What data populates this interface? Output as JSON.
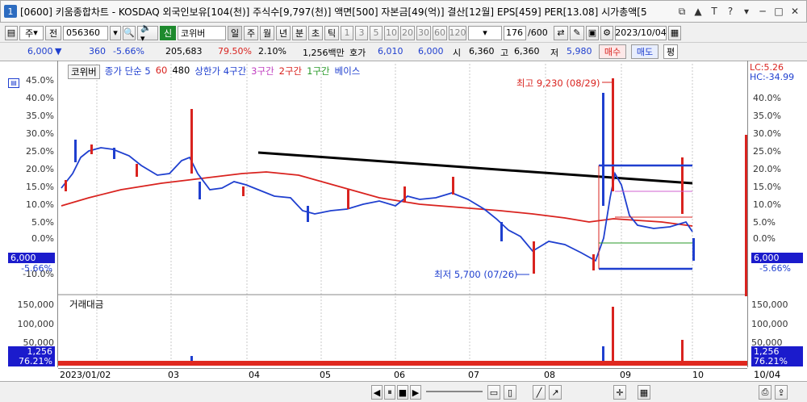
{
  "window": {
    "number": "1",
    "title": "[0600] 키움종합차트 - KOSDAQ 외국인보유[104(천)] 주식수[9,797(천)] 액면[500] 자본금[49(억)] 결산[12월] EPS[459] PER[13.08] 시가총액[5",
    "buttons": [
      "◫",
      "▲",
      "T",
      "?",
      "▾",
      "─",
      "□",
      "✕"
    ]
  },
  "toolbar": {
    "type_select": "주",
    "prev_label": "전",
    "code": "056360",
    "search_icon": "magnifier",
    "credit_label": "신",
    "stock_name": "코위버",
    "periods": [
      "일",
      "주",
      "월",
      "년",
      "분",
      "초",
      "틱"
    ],
    "period_selected": "일",
    "ticks": [
      "1",
      "3",
      "5",
      "10",
      "20",
      "30",
      "60",
      "120"
    ],
    "count": "176",
    "count_total": "/600",
    "date": "2023/10/04"
  },
  "quote": {
    "price": "6,000",
    "change_arrow": "▼",
    "change": "360",
    "change_pct": "-5.66%",
    "volume": "205,683",
    "vol_ratio": "79.50%",
    "turnover": "2.10%",
    "amount": "1,256백만",
    "ask_label": "호가",
    "ask": "6,010",
    "bid": "6,000",
    "open_label": "시",
    "open": "6,360",
    "high_label": "고",
    "high": "6,360",
    "low_label": "저",
    "low": "5,980",
    "buy_btn": "매수",
    "sell_btn": "매도",
    "eval_btn": "평"
  },
  "legend": {
    "name": "코위버",
    "ma": "종가 단순 5",
    "ma60": "60",
    "ma480": "480",
    "bands": "상한가 4구간",
    "b3": "3구간",
    "b2": "2구간",
    "b1": "1구간",
    "base": "베이스"
  },
  "axis": {
    "left_price": [
      "45.0%",
      "40.0%",
      "35.0%",
      "30.0%",
      "25.0%",
      "20.0%",
      "15.0%",
      "10.0%",
      "5.0%",
      "0.0%",
      "-5.0%",
      "-10.0%"
    ],
    "right_price": [
      "45.0%",
      "40.0%",
      "35.0%",
      "30.0%",
      "25.0%",
      "20.0%",
      "15.0%",
      "10.0%",
      "5.0%",
      "0.0%",
      "-5.0%",
      "-10.0%"
    ],
    "lc": "LC:5.26",
    "hc": "HC:-34.99",
    "current_price": "6,000",
    "current_pct": "-5.66%",
    "vol_title": "거래대금",
    "vol_ticks": [
      "150,000",
      "100,000",
      "50,000"
    ],
    "vol_current": "1,256",
    "vol_pct": "76.21%",
    "dates": [
      "2023/01/02",
      "03",
      "04",
      "05",
      "06",
      "07",
      "08",
      "09",
      "10"
    ],
    "right_date": "10/04"
  },
  "annotations": {
    "high": "최고 9,230 (08/29)",
    "low": "최저 5,700 (07/26)"
  },
  "colors": {
    "up": "#d9231f",
    "down": "#1f3fcf",
    "ma60": "#d9231f",
    "ma5": "#1f3fcf",
    "trend": "#000000"
  }
}
